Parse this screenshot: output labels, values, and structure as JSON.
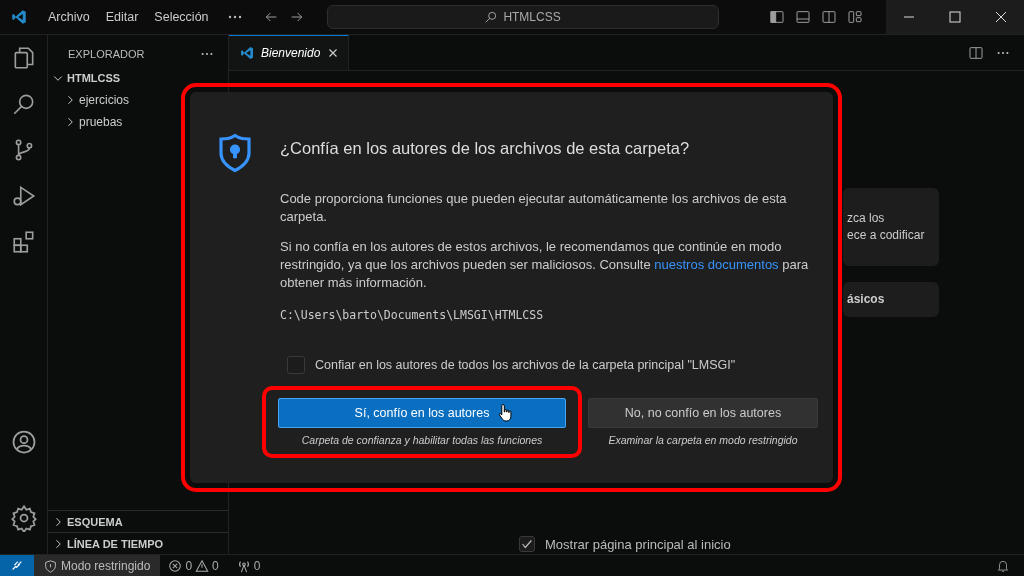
{
  "title_bar": {
    "menu": [
      "Archivo",
      "Editar",
      "Selección"
    ],
    "search": {
      "value": "HTMLCSS"
    }
  },
  "sidebar": {
    "title": "EXPLORADOR",
    "tree": {
      "label": "HTMLCSS",
      "expanded": true,
      "children": [
        {
          "label": "ejercicios",
          "expanded": false
        },
        {
          "label": "pruebas",
          "expanded": false
        }
      ]
    },
    "sections": [
      {
        "label": "ESQUEMA",
        "expanded": false
      },
      {
        "label": "LÍNEA DE TIEMPO",
        "expanded": false
      }
    ]
  },
  "tabs": [
    {
      "label": "Bienvenido",
      "selected": true
    }
  ],
  "welcome": {
    "cards": [
      {
        "lines": [
          "zca los",
          "ece a codificar"
        ]
      },
      {
        "lines": [
          "ásicos"
        ]
      }
    ],
    "show_on_startup": {
      "label": "Mostrar página principal al inicio",
      "checked": true
    }
  },
  "dialog": {
    "highlighted": true,
    "title": "¿Confía en los autores de los archivos de esta carpeta?",
    "paragraph_1": "Code proporciona funciones que pueden ejecutar automáticamente los archivos de esta carpeta.",
    "paragraph_2": {
      "text": "Si no confía en los autores de estos archivos, le recomendamos que continúe en modo restringido, ya que los archivos pueden ser maliciosos. Consulte ",
      "link": "nuestros documentos",
      "text_after": " para obtener más información."
    },
    "path": "C:\\Users\\barto\\Documents\\LMSGI\\HTMLCSS",
    "checkbox": {
      "label": "Confiar en los autores de todos los archivos de la carpeta principal \"LMSGI\"",
      "checked": false
    },
    "buttons": [
      {
        "label": "Sí, confío en los autores",
        "caption": "Carpeta de confianza y habilitar todas las funciones",
        "primary": true,
        "highlighted": true
      },
      {
        "label": "No, no confío en los autores",
        "caption": "Examinar la carpeta en modo restringido",
        "primary": false,
        "highlighted": false
      }
    ]
  },
  "status_bar": {
    "restricted_mode": "Modo restringido",
    "errors": "0",
    "warnings": "0",
    "ports": "0"
  }
}
